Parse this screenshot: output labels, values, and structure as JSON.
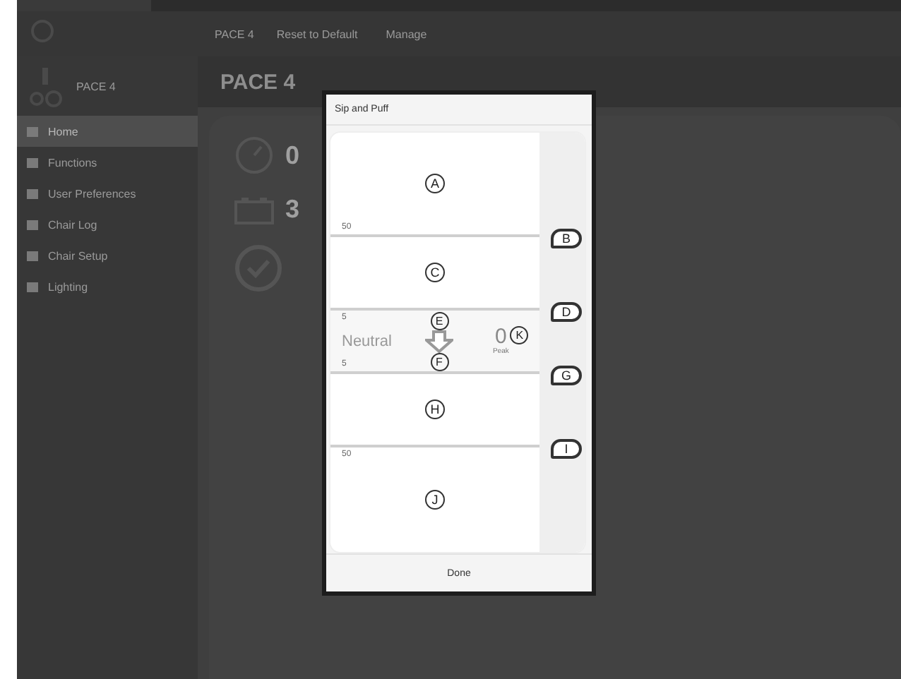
{
  "toolbar": {
    "page": "PACE 4",
    "actions": [
      "Reset to Default",
      "Manage"
    ]
  },
  "sidebar": {
    "device": "PACE 4",
    "items": [
      {
        "label": "Home",
        "selected": true
      },
      {
        "label": "Functions",
        "selected": false
      },
      {
        "label": "User Preferences",
        "selected": false
      },
      {
        "label": "Chair Log",
        "selected": false
      },
      {
        "label": "Chair Setup",
        "selected": false
      },
      {
        "label": "Lighting",
        "selected": false
      }
    ]
  },
  "content": {
    "banner": "PACE 4",
    "stats": [
      "0",
      "3"
    ]
  },
  "dialog": {
    "title": "Sip and Puff",
    "zones": [
      {
        "kind": "region",
        "marker": "A",
        "bottom_scale": "50",
        "callout": "B"
      },
      {
        "kind": "region",
        "marker": "C",
        "callout": "D"
      },
      {
        "kind": "neutral",
        "label": "Neutral",
        "top_scale": "5",
        "bottom_scale": "5",
        "top_marker": "E",
        "bottom_marker": "F",
        "reading": "0",
        "reading_caption": "Peak",
        "reading_marker": "K",
        "callout": "G"
      },
      {
        "kind": "region",
        "marker": "H",
        "callout": "I"
      },
      {
        "kind": "region",
        "marker": "J",
        "top_scale": "50"
      }
    ],
    "button": "Done"
  }
}
